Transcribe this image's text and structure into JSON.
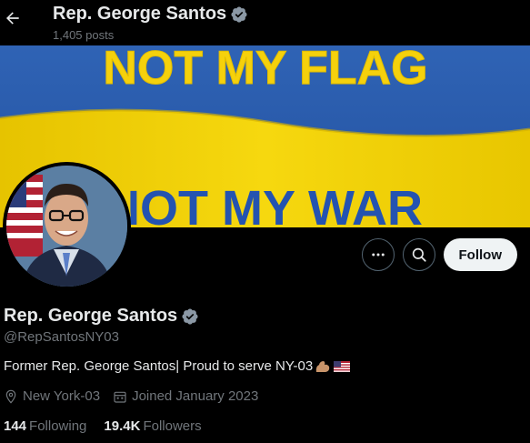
{
  "header": {
    "name": "Rep. George Santos",
    "posts": "1,405 posts",
    "back_icon": "arrow-left-icon",
    "verified_icon": "verified-badge-icon"
  },
  "banner": {
    "line1": "NOT MY FLAG",
    "line2": "NOT MY WAR",
    "colors": {
      "blue": "#2a5fb0",
      "yellow": "#f5d10c"
    }
  },
  "actions": {
    "more_icon": "ellipsis-icon",
    "search_icon": "search-icon",
    "follow_label": "Follow"
  },
  "profile": {
    "name": "Rep. George Santos",
    "handle": "@RepSantosNY03",
    "bio": "Former Rep. George Santos| Proud to serve NY-03",
    "location": "New York-03",
    "joined": "Joined January 2023",
    "following_count": "144",
    "following_label": "Following",
    "followers_count": "19.4K",
    "followers_label": "Followers"
  },
  "colors": {
    "background": "#000000",
    "text": "#e7e9ea",
    "muted": "#71767b",
    "verified": "#8b98a5",
    "button": "#eff3f4"
  }
}
